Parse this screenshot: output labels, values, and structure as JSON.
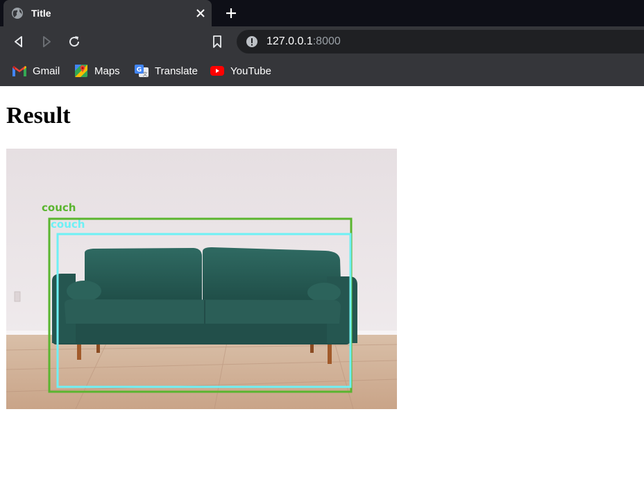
{
  "browser": {
    "tab": {
      "title": "Title"
    },
    "address": {
      "host": "127.0.0.1",
      "port": ":8000"
    },
    "bookmarks": [
      {
        "label": "Gmail",
        "icon": "gmail-icon"
      },
      {
        "label": "Maps",
        "icon": "maps-icon"
      },
      {
        "label": "Translate",
        "icon": "translate-icon"
      },
      {
        "label": "YouTube",
        "icon": "youtube-icon"
      }
    ]
  },
  "page": {
    "title": "Result",
    "detections": [
      {
        "label": "couch",
        "color": "#5ab52f"
      },
      {
        "label": "couch",
        "color": "#6ef0f5"
      }
    ]
  },
  "colors": {
    "tabstrip": "#0e0f17",
    "toolbar": "#35363a",
    "omnibox": "#1f2023",
    "sofa": "#2b5e57"
  }
}
